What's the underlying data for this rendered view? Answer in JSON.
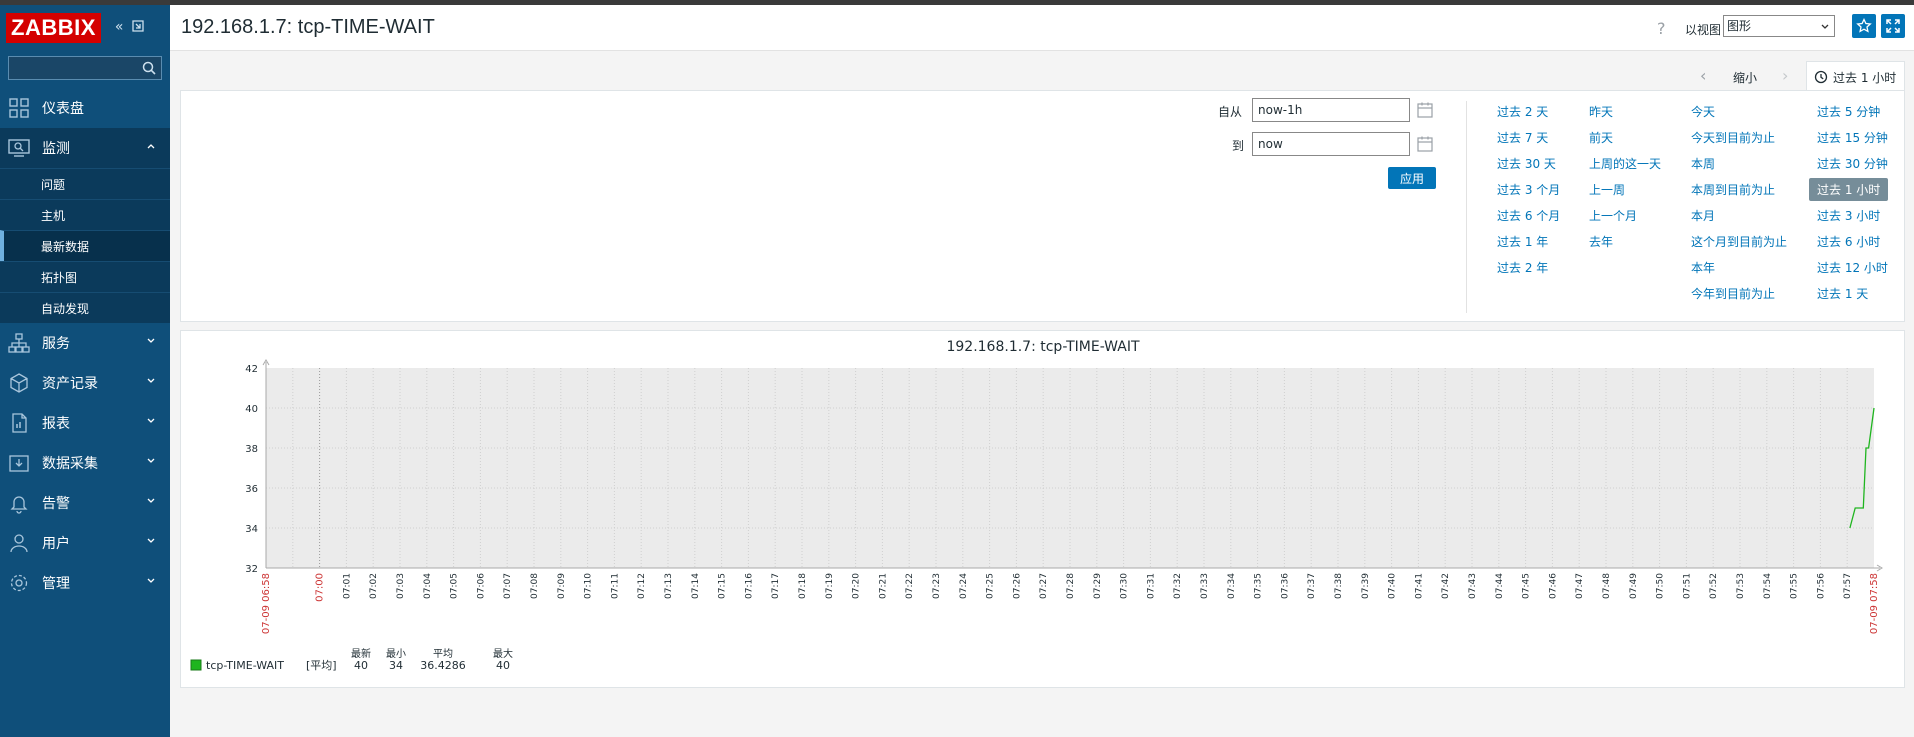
{
  "sidebar": {
    "logo": "ZABBIX",
    "search_placeholder": "",
    "menu": [
      {
        "label": "仪表盘",
        "icon": "dashboard-icon"
      },
      {
        "label": "监测",
        "icon": "monitoring-icon"
      },
      {
        "label": "服务",
        "icon": "services-icon"
      },
      {
        "label": "资产记录",
        "icon": "inventory-icon"
      },
      {
        "label": "报表",
        "icon": "reports-icon"
      },
      {
        "label": "数据采集",
        "icon": "data-collection-icon"
      },
      {
        "label": "告警",
        "icon": "alerts-icon"
      },
      {
        "label": "用户",
        "icon": "users-icon"
      },
      {
        "label": "管理",
        "icon": "administration-icon"
      }
    ],
    "submenu": [
      "问题",
      "主机",
      "最新数据",
      "拓扑图",
      "自动发现"
    ]
  },
  "header": {
    "title": "192.168.1.7: tcp-TIME-WAIT",
    "help": "?",
    "view_label": "以视图",
    "view_value": "图形"
  },
  "timebar": {
    "zoom": "缩小",
    "current": "过去 1 小时"
  },
  "filter": {
    "from_label": "自从",
    "from_value": "now-1h",
    "to_label": "到",
    "to_value": "now",
    "apply": "应用",
    "quick": [
      [
        "过去 2 天",
        "过去 7 天",
        "过去 30 天",
        "过去 3 个月",
        "过去 6 个月",
        "过去 1 年",
        "过去 2 年"
      ],
      [
        "昨天",
        "前天",
        "上周的这一天",
        "上一周",
        "上一个月",
        "去年"
      ],
      [
        "今天",
        "今天到目前为止",
        "本周",
        "本周到目前为止",
        "本月",
        "这个月到目前为止",
        "本年",
        "今年到目前为止"
      ],
      [
        "过去 5 分钟",
        "过去 15 分钟",
        "过去 30 分钟",
        "过去 1 小时",
        "过去 3 小时",
        "过去 6 小时",
        "过去 12 小时",
        "过去 1 天"
      ]
    ],
    "selected": "过去 1 小时"
  },
  "chart_data": {
    "type": "line",
    "title": "192.168.1.7: tcp-TIME-WAIT",
    "ylim": [
      32,
      42
    ],
    "yticks": [
      "42",
      "40",
      "38",
      "36",
      "34",
      "32"
    ],
    "x_start_label": "07-09 06:58",
    "x_end_label": "07-09 07:58",
    "x_minute_labels": [
      "07:00",
      "07:01",
      "07:02",
      "07:03",
      "07:04",
      "07:05",
      "07:06",
      "07:07",
      "07:08",
      "07:09",
      "07:10",
      "07:11",
      "07:12",
      "07:13",
      "07:14",
      "07:15",
      "07:16",
      "07:17",
      "07:18",
      "07:19",
      "07:20",
      "07:21",
      "07:22",
      "07:23",
      "07:24",
      "07:25",
      "07:26",
      "07:27",
      "07:28",
      "07:29",
      "07:30",
      "07:31",
      "07:32",
      "07:33",
      "07:34",
      "07:35",
      "07:36",
      "07:37",
      "07:38",
      "07:39",
      "07:40",
      "07:41",
      "07:42",
      "07:43",
      "07:44",
      "07:45",
      "07:46",
      "07:47",
      "07:48",
      "07:49",
      "07:50",
      "07:51",
      "07:52",
      "07:53",
      "07:54",
      "07:55",
      "07:56",
      "07:57"
    ],
    "series": [
      {
        "name": "tcp-TIME-WAIT",
        "color": "#1fb51f",
        "points": [
          {
            "x": "07:57.1",
            "y": 34
          },
          {
            "x": "07:57.3",
            "y": 35
          },
          {
            "x": "07:57.6",
            "y": 35
          },
          {
            "x": "07:57.7",
            "y": 38
          },
          {
            "x": "07:57.8",
            "y": 38
          },
          {
            "x": "07:58",
            "y": 40
          }
        ]
      }
    ],
    "legend": {
      "name": "tcp-TIME-WAIT",
      "func": "[平均]",
      "headers": [
        "最新",
        "最小",
        "平均",
        "最大"
      ],
      "values": [
        "40",
        "34",
        "36.4286",
        "40"
      ]
    }
  }
}
